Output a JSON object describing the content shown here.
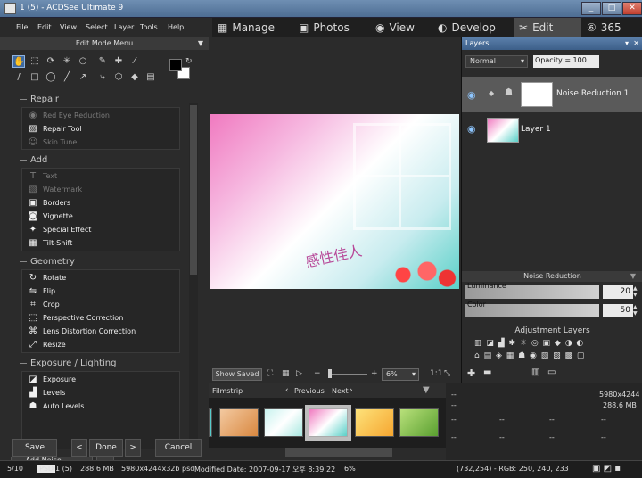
{
  "window": {
    "title": "1 (5) - ACDSee Ultimate 9",
    "min": "_",
    "max": "□",
    "close": "✕"
  },
  "menu": [
    "File",
    "Edit",
    "View",
    "Select",
    "Layer",
    "Tools",
    "Help"
  ],
  "modes": [
    {
      "label": "Manage",
      "icon": "▦"
    },
    {
      "label": "Photos",
      "icon": "▣"
    },
    {
      "label": "View",
      "icon": "◉"
    },
    {
      "label": "Develop",
      "icon": "◐"
    },
    {
      "label": "Edit",
      "icon": "✂"
    },
    {
      "label": "365",
      "icon": "⑥"
    }
  ],
  "left": {
    "header": "Edit Mode Menu",
    "sections": {
      "repair": {
        "title": "Repair",
        "items": [
          "Red Eye Reduction",
          "Repair Tool",
          "Skin Tune"
        ]
      },
      "add": {
        "title": "Add",
        "items": [
          "Text",
          "Watermark",
          "Borders",
          "Vignette",
          "Special Effect",
          "Tilt-Shift"
        ]
      },
      "geometry": {
        "title": "Geometry",
        "items": [
          "Rotate",
          "Flip",
          "Crop",
          "Perspective Correction",
          "Lens Distortion Correction",
          "Resize"
        ]
      },
      "exposure": {
        "title": "Exposure / Lighting",
        "items": [
          "Exposure",
          "Levels",
          "Auto Levels"
        ]
      }
    },
    "add_noise_reduction": "Add Noise Reduction",
    "save": "Save",
    "done": "Done",
    "cancel": "Cancel",
    "prev": "<",
    "next": ">"
  },
  "canvas": {
    "photo_text": "感性佳人",
    "show_saved": "Show Saved",
    "zoom": "6%",
    "ratio": "1:1"
  },
  "filmstrip": {
    "title": "Filmstrip",
    "previous": "Previous",
    "next": "Next"
  },
  "info": {
    "dims": "5980x4244",
    "size": "288.6 MB",
    "dash": "--"
  },
  "layers": {
    "title": "Layers",
    "blend": "Normal",
    "opacity": "Opacity = 100",
    "items": [
      {
        "name": "Noise Reduction 1"
      },
      {
        "name": "Layer 1"
      }
    ]
  },
  "noise_reduction": {
    "title": "Noise Reduction",
    "luminance_label": "Luminance",
    "luminance": 20,
    "color_label": "Color",
    "color": 50
  },
  "adjustment_layers": {
    "title": "Adjustment Layers"
  },
  "status": {
    "index": "5/10",
    "format": "PSD",
    "file": "1 (5)",
    "size": "288.6 MB",
    "dims": "5980x4244x32b psd",
    "modified": "Modified Date: 2007-09-17 오후 8:39:22",
    "zoom": "6%",
    "pixel": "(732,254) - RGB: 250, 240, 233"
  }
}
